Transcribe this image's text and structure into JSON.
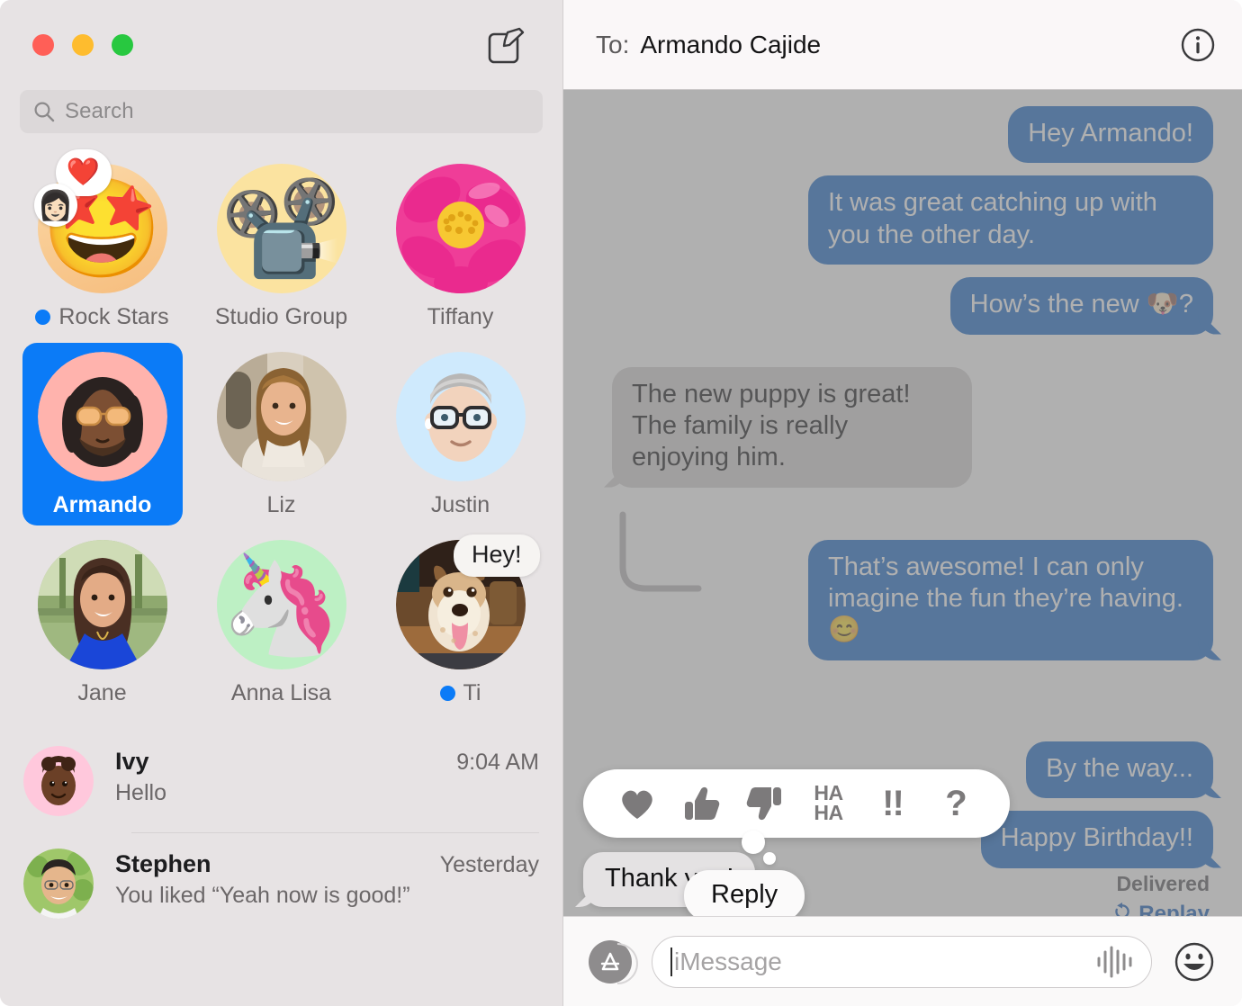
{
  "window": {
    "traffic_lights": [
      "close",
      "minimize",
      "zoom"
    ],
    "compose_icon": "compose-icon"
  },
  "search": {
    "placeholder": "Search",
    "icon": "search-icon"
  },
  "sidebar": {
    "pinned": [
      {
        "name": "Rock Stars",
        "avatar_kind": "emoji",
        "glyph": "🤩",
        "bg": "#f9c98b",
        "unread": true,
        "badge": {
          "reaction": "❤️",
          "face": "👩🏻"
        }
      },
      {
        "name": "Studio Group",
        "avatar_kind": "emoji",
        "glyph": "📽️",
        "bg": "#fbe3a0",
        "unread": false
      },
      {
        "name": "Tiffany",
        "avatar_kind": "photo-flower",
        "bg": "#e8368f",
        "unread": false
      },
      {
        "name": "Armando",
        "avatar_kind": "memoji-armando",
        "bg": "#ffb3ad",
        "unread": false,
        "selected": true
      },
      {
        "name": "Liz",
        "avatar_kind": "photo-liz",
        "bg": "#b9ad9a",
        "unread": false
      },
      {
        "name": "Justin",
        "avatar_kind": "memoji-justin",
        "bg": "#cfeafd",
        "unread": false
      },
      {
        "name": "Jane",
        "avatar_kind": "photo-jane",
        "bg": "#7fa06a",
        "unread": false
      },
      {
        "name": "Anna Lisa",
        "avatar_kind": "emoji",
        "glyph": "🦄",
        "bg": "#bdf0c4",
        "unread": false
      },
      {
        "name": "Ti",
        "avatar_kind": "photo-dog",
        "bg": "#6b4a2c",
        "unread": true,
        "preview": "Hey!"
      }
    ],
    "conversations": [
      {
        "name": "Ivy",
        "snippet": "Hello",
        "time": "9:04 AM",
        "avatar_kind": "memoji-ivy",
        "bg": "#ffc8dc"
      },
      {
        "name": "Stephen",
        "snippet": "You liked “Yeah now is good!”",
        "time": "Yesterday",
        "avatar_kind": "photo-stephen",
        "bg": "#9fc76a"
      }
    ]
  },
  "pane": {
    "header": {
      "to_label": "To:",
      "recipient": "Armando Cajide",
      "info_icon": "info-icon"
    },
    "messages": [
      {
        "id": "m1",
        "from": "me",
        "text": "Hey Armando!",
        "tail": false
      },
      {
        "id": "m2",
        "from": "me",
        "text": "It was great catching up with you the other day.",
        "tail": false
      },
      {
        "id": "m3",
        "from": "me",
        "text": "How’s the new 🐶?",
        "tail": true
      },
      {
        "id": "m4",
        "from": "them",
        "text": "The new puppy is great! The family is really enjoying him.",
        "tail": true
      },
      {
        "id": "m5",
        "from": "me",
        "text": "That’s awesome! I can only imagine the fun they’re having. 😊",
        "tail": true
      },
      {
        "id": "m6",
        "from": "me",
        "text": "By the way...",
        "tail": true
      },
      {
        "id": "m7",
        "from": "me",
        "text": "Happy Birthday!!",
        "tail": true
      }
    ],
    "status": {
      "delivered": "Delivered",
      "replay": "Replay",
      "replay_icon": "replay-icon"
    },
    "tapback": {
      "options": [
        {
          "name": "heart",
          "icon": "heart-icon",
          "label": ""
        },
        {
          "name": "thumbs-up",
          "icon": "thumbs-up-icon",
          "label": ""
        },
        {
          "name": "thumbs-down",
          "icon": "thumbs-down-icon",
          "label": ""
        },
        {
          "name": "haha",
          "icon": "haha-icon",
          "label": "HA\nHA"
        },
        {
          "name": "exclamation",
          "icon": "exclamation-icon",
          "label": "!!"
        },
        {
          "name": "question",
          "icon": "question-icon",
          "label": "?"
        }
      ],
      "haha_line1": "HA",
      "haha_line2": "HA",
      "bang_label": "!!",
      "question_label": "?",
      "focused_message": "Thank you!",
      "reply_label": "Reply"
    },
    "composer": {
      "apps_icon": "app-store-icon",
      "placeholder": "iMessage",
      "value": "",
      "audio_icon": "audio-waveform-icon",
      "emoji_icon": "emoji-smiley-icon"
    }
  },
  "colors": {
    "accent_blue": "#0b7bf7",
    "bubble_out": "#1567c8",
    "bubble_in": "#d4d2d3",
    "sidebar_bg": "#e7e3e4",
    "dim_overlay": "rgba(128,128,128,0.62)",
    "unread_dot": "#0b7bf7"
  }
}
